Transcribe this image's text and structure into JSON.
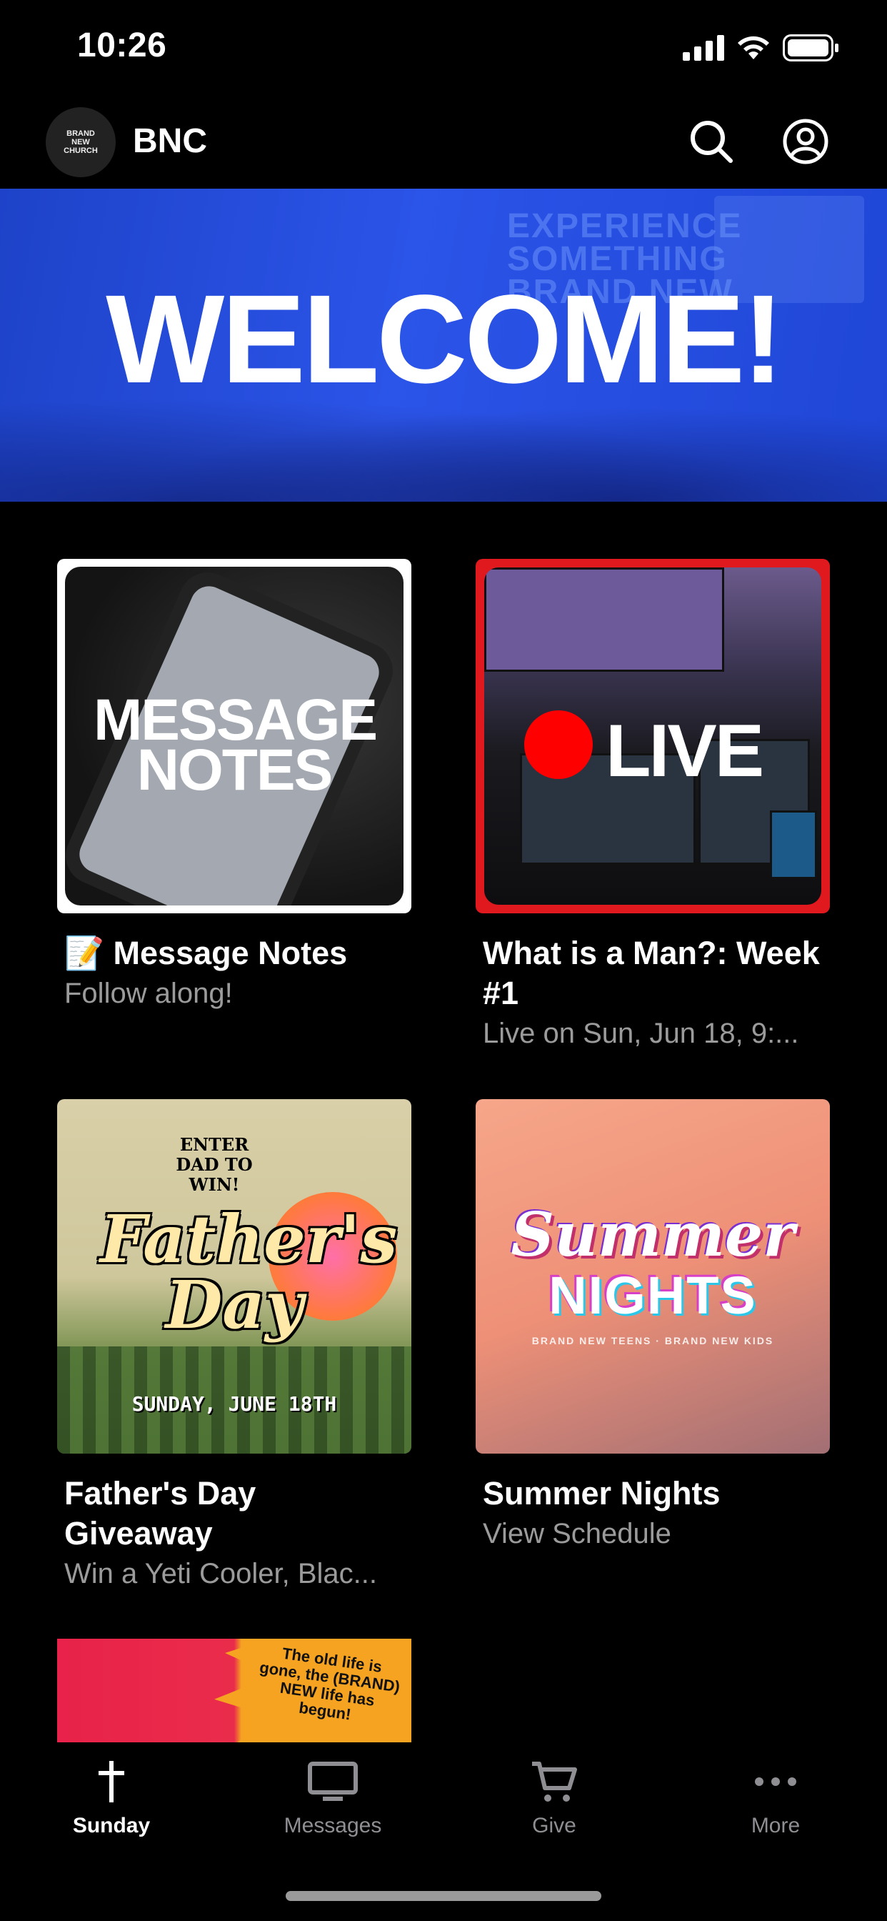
{
  "status_bar": {
    "time": "10:26"
  },
  "header": {
    "logo_text": "BRAND NEW CHURCH",
    "title": "BNC"
  },
  "banner": {
    "title": "WELCOME!",
    "background_text": "EXPERIENCE SOMETHING BRAND NEW"
  },
  "cards": [
    {
      "thumb_text": "MESSAGE NOTES",
      "title": "📝 Message Notes",
      "subtitle": "Follow along!"
    },
    {
      "thumb_text": "LIVE",
      "title": "What is a Man?: Week #1",
      "subtitle": "Live on Sun, Jun 18, 9:..."
    },
    {
      "thumb_top": "ENTER DAD TO WIN!",
      "thumb_title": "Father's Day",
      "thumb_date": "SUNDAY, JUNE 18TH",
      "title": "Father's Day Giveaway",
      "subtitle": "Win a Yeti Cooler, Blac..."
    },
    {
      "thumb_line1": "Summer",
      "thumb_line2": "NIGHTS",
      "thumb_logos": "BRAND NEW TEENS · BRAND NEW KIDS",
      "title": "Summer Nights",
      "subtitle": "View Schedule"
    }
  ],
  "partial_card": {
    "thumb_text": "The old life is gone, the (BRAND) NEW life has begun!"
  },
  "tabs": [
    {
      "label": "Sunday",
      "icon": "cross-icon",
      "active": true
    },
    {
      "label": "Messages",
      "icon": "tv-icon",
      "active": false
    },
    {
      "label": "Give",
      "icon": "cart-icon",
      "active": false
    },
    {
      "label": "More",
      "icon": "ellipsis-icon",
      "active": false
    }
  ],
  "colors": {
    "background": "#000000",
    "live_red": "#e0191e",
    "banner_blue": "#2b54e8",
    "inactive_tab": "#8e8e93"
  }
}
